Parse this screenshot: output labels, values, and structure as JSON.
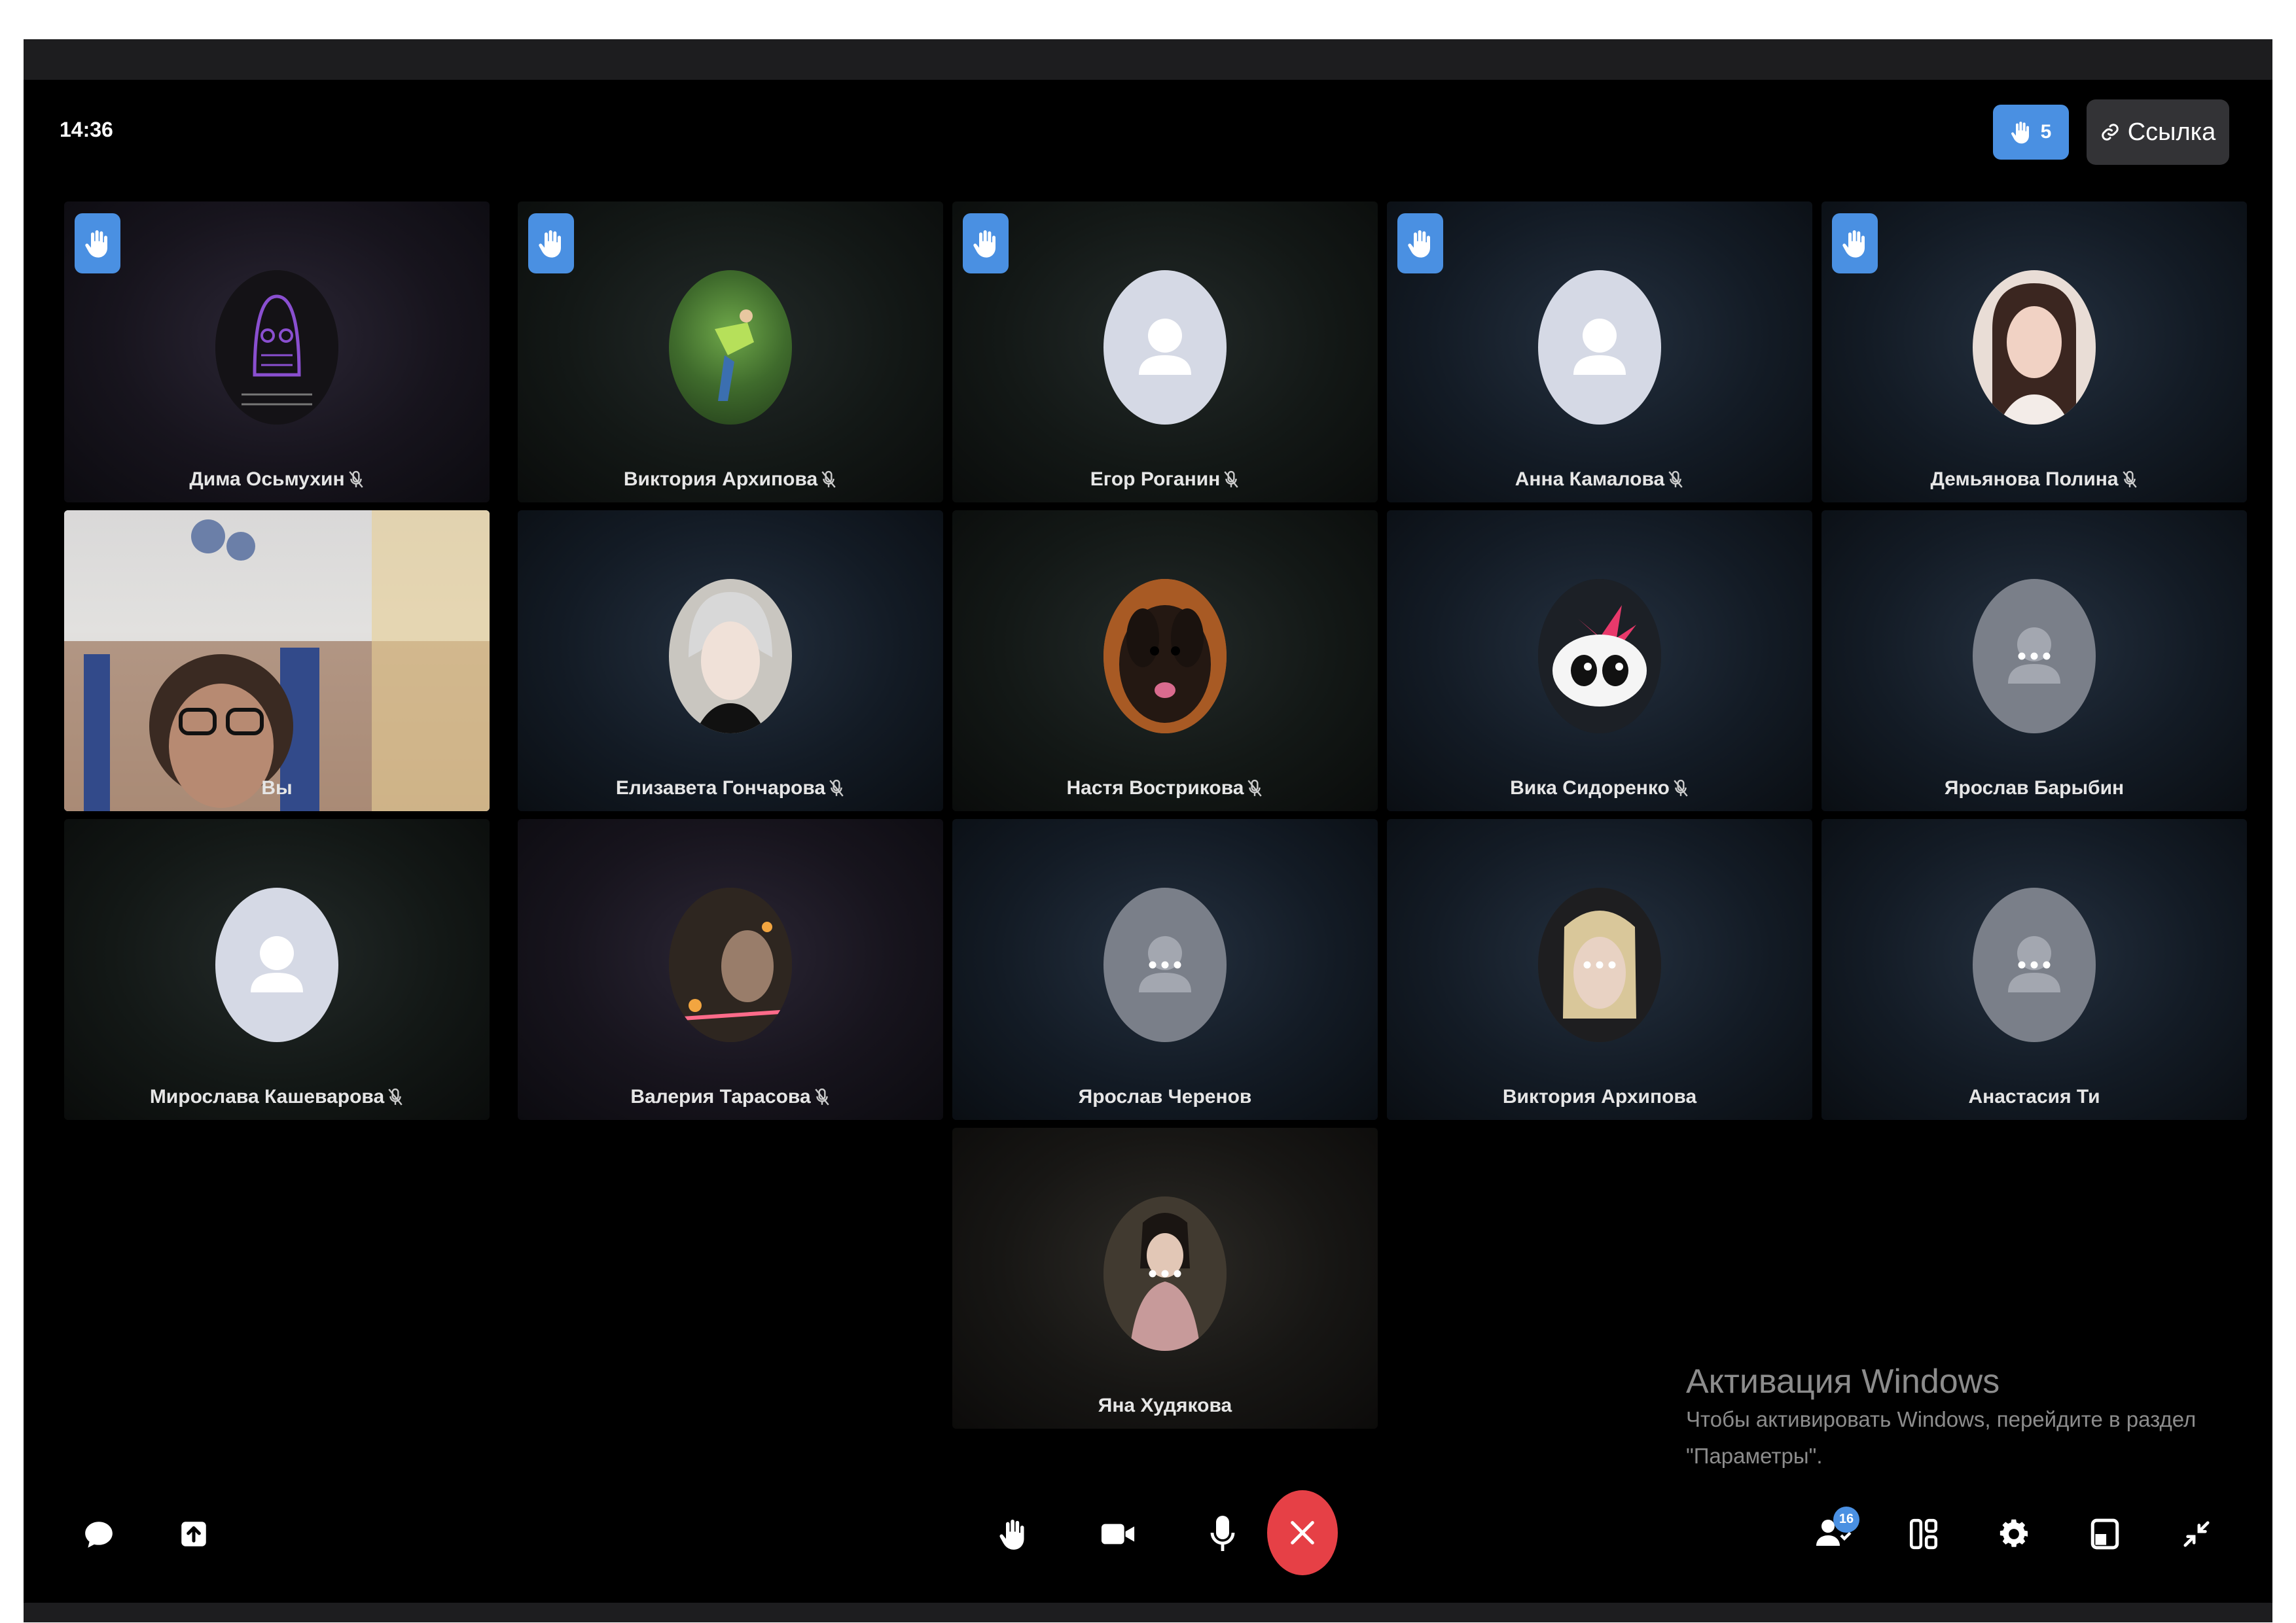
{
  "clock": "14:36",
  "header": {
    "raised_hands_count": "5",
    "link_label": "Ссылка"
  },
  "participants": [
    {
      "name": "Дима Осьмухин",
      "hand_raised": true,
      "muted": true
    },
    {
      "name": "Виктория Архипова",
      "hand_raised": true,
      "muted": true
    },
    {
      "name": "Егор Роганин",
      "hand_raised": true,
      "muted": true
    },
    {
      "name": "Анна Камалова",
      "hand_raised": true,
      "muted": true
    },
    {
      "name": "Демьянова Полина",
      "hand_raised": true,
      "muted": true
    },
    {
      "name": "Вы",
      "hand_raised": false,
      "muted": false
    },
    {
      "name": "Елизавета Гончарова",
      "hand_raised": false,
      "muted": true
    },
    {
      "name": "Настя Вострикова",
      "hand_raised": false,
      "muted": true
    },
    {
      "name": "Вика Сидоренко",
      "hand_raised": false,
      "muted": true
    },
    {
      "name": "Ярослав Барыбин",
      "hand_raised": false,
      "muted": false
    },
    {
      "name": "Мирослава Кашеварова",
      "hand_raised": false,
      "muted": true
    },
    {
      "name": "Валерия Тарасова",
      "hand_raised": false,
      "muted": true
    },
    {
      "name": "Ярослав Черенов",
      "hand_raised": false,
      "muted": false
    },
    {
      "name": "Виктория Архипова",
      "hand_raised": false,
      "muted": false
    },
    {
      "name": "Анастасия Ти",
      "hand_raised": false,
      "muted": false
    },
    {
      "name": "Яна Худякова",
      "hand_raised": false,
      "muted": false
    }
  ],
  "watermark": {
    "title": "Активация Windows",
    "text": "Чтобы активировать Windows, перейдите в раздел \"Параметры\"."
  },
  "controls": {
    "participants_count": "16"
  },
  "colors": {
    "accent": "#4a90e2",
    "end_call": "#e64046",
    "background": "#000000"
  }
}
